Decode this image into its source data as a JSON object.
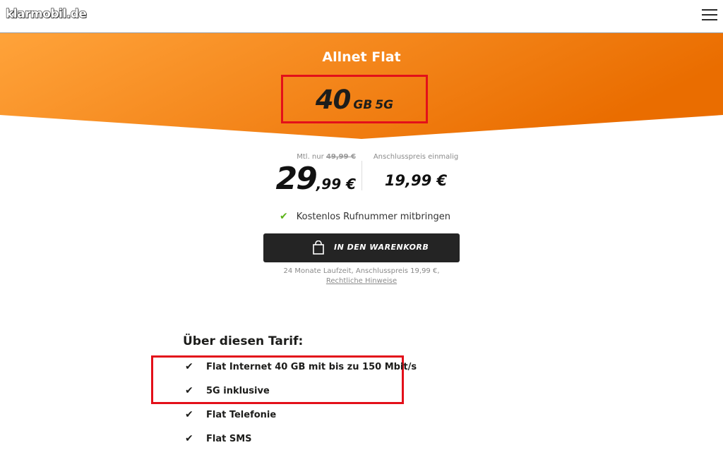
{
  "header": {
    "logo_text": "klarmobil.de",
    "menu_icon": "hamburger-menu-icon"
  },
  "colors": {
    "banner_light": "#ffa33a",
    "banner_dark": "#ea6d00",
    "highlight": "#e3101a",
    "check_green": "#5bb318",
    "button_bg": "#242424"
  },
  "banner": {
    "tariff_name": "Allnet Flat",
    "volume_number": "40",
    "volume_unit": "GB",
    "volume_tech": "5G"
  },
  "pricing": {
    "monthly_label": "Mtl. nur",
    "old_price": "49,99 €",
    "price_int": "29",
    "price_cents": ",99 €",
    "setup_label": "Anschlusspreis einmalig",
    "setup_price": "19,99 €"
  },
  "feature_check": {
    "icon": "check-icon",
    "text": "Kostenlos Rufnummer mitbringen"
  },
  "cart_button": {
    "icon": "shopping-bag-icon",
    "label": "IN DEN WARENKORB"
  },
  "contract_note": "24 Monate Laufzeit, Anschlusspreis 19,99 €,",
  "legal_link": "Rechtliche Hinweise",
  "about": {
    "title": "Über diesen Tarif:",
    "features": [
      "Flat Internet 40 GB mit bis zu 150 Mbit/s",
      "5G inklusive",
      "Flat Telefonie",
      "Flat SMS"
    ]
  }
}
